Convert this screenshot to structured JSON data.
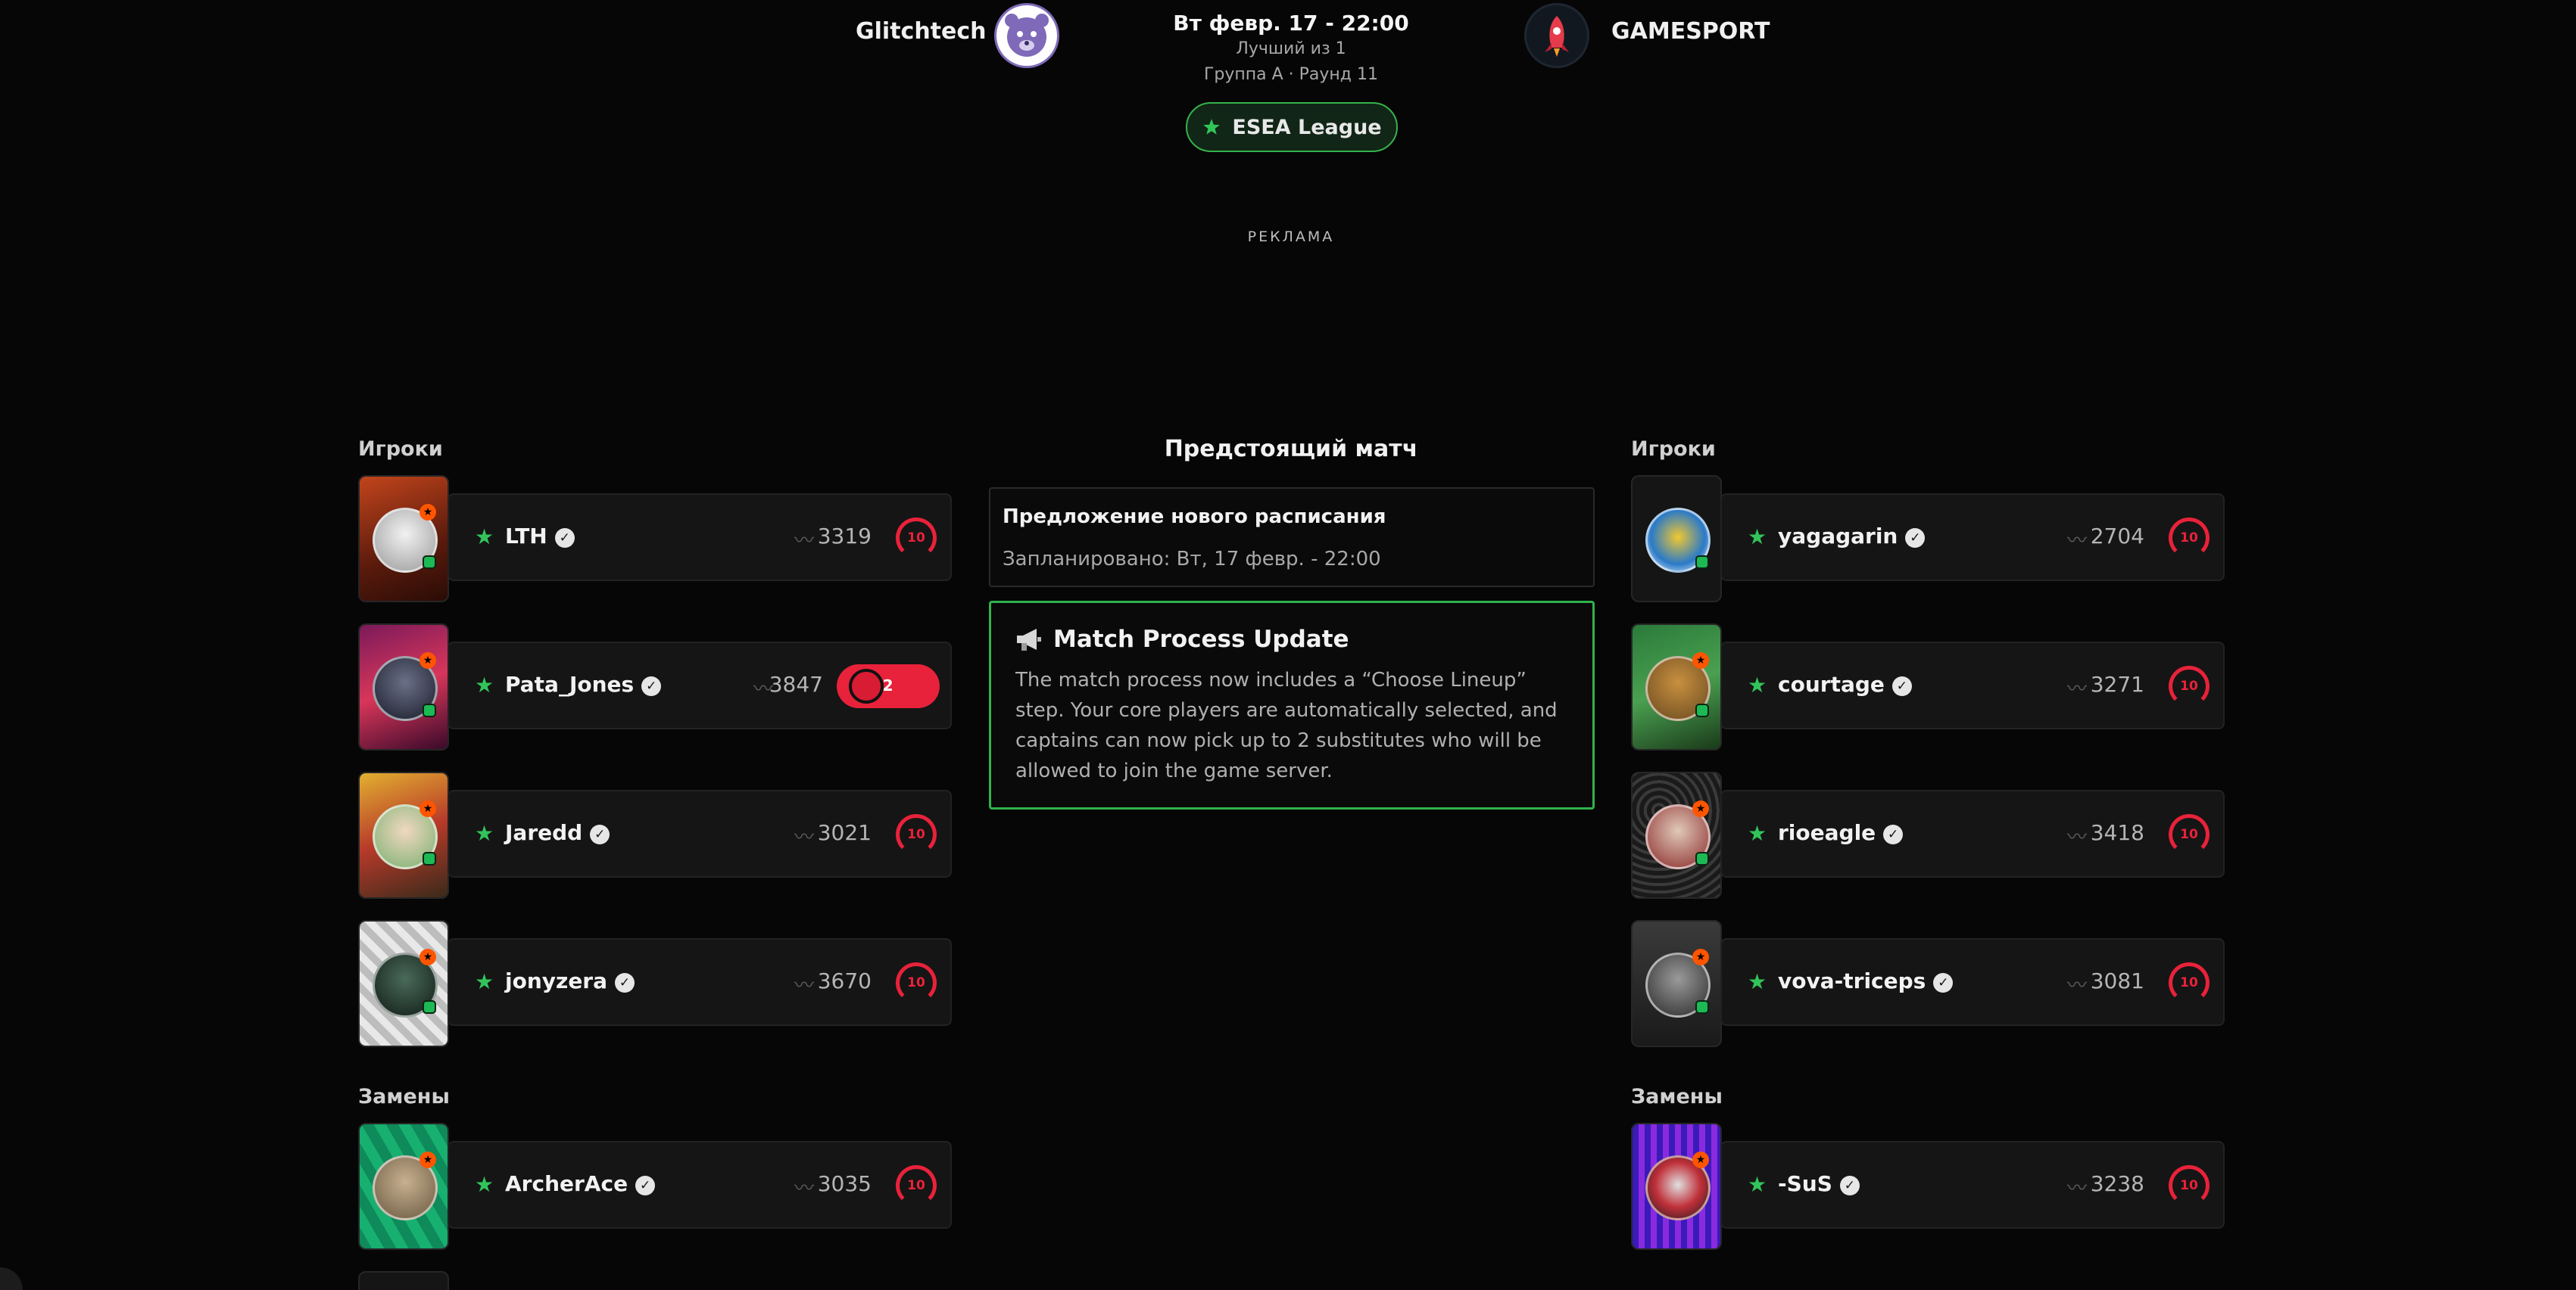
{
  "header": {
    "team_left": "Glitchtech",
    "team_right": "GAMESPORT",
    "date": "Вт февр. 17 - 22:00",
    "best_of": "Лучший из 1",
    "group_round": "Группа A · Раунд 11",
    "league": "ESEA League",
    "ad_label": "РЕКЛАМА"
  },
  "left": {
    "players_title": "Игроки",
    "subs_title": "Замены",
    "players": [
      {
        "name": "LTH",
        "elo": "3319",
        "level": "10"
      },
      {
        "name": "Pata_Jones",
        "elo": "3847",
        "rank": "#582"
      },
      {
        "name": "Jaredd",
        "elo": "3021",
        "level": "10"
      },
      {
        "name": "jonyzera",
        "elo": "3670",
        "level": "10"
      }
    ],
    "subs": [
      {
        "name": "ArcherAce",
        "elo": "3035",
        "level": "10"
      }
    ]
  },
  "right": {
    "players_title": "Игроки",
    "subs_title": "Замены",
    "players": [
      {
        "name": "yagagarin",
        "elo": "2704",
        "level": "10"
      },
      {
        "name": "courtage",
        "elo": "3271",
        "level": "10"
      },
      {
        "name": "rioeagle",
        "elo": "3418",
        "level": "10"
      },
      {
        "name": "vova-triceps",
        "elo": "3081",
        "level": "10"
      }
    ],
    "subs": [
      {
        "name": "-SuS",
        "elo": "3238",
        "level": "10"
      }
    ]
  },
  "center": {
    "title": "Предстоящий матч",
    "schedule_title": "Предложение нового расписания",
    "schedule_text": "Запланировано: Вт, 17 февр. - 22:00",
    "update_title": "Match Process Update",
    "update_text": "The match process now includes a “Choose Lineup” step. Your core players are automatically selected, and captains can now pick up to 2 substitutes who will be allowed to join the game server."
  },
  "colors": {
    "accent_green": "#2fb24d",
    "level_red": "#e8223a",
    "background": "#060606"
  },
  "icons": {
    "league": "faceit-star-icon",
    "verified": "verified-check-icon",
    "trend": "trend-icon",
    "update": "megaphone-icon"
  }
}
